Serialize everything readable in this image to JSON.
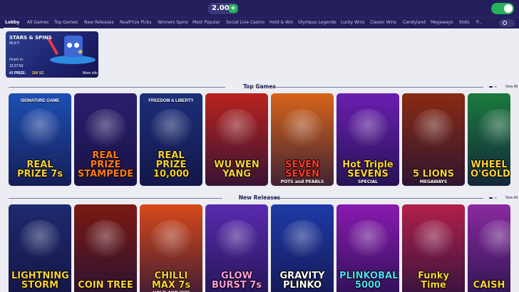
{
  "header": {
    "balance": "2.00",
    "add_icon": "plus-icon",
    "toggle_state": "on",
    "accent_color": "#27b35a",
    "bar_color": "#221f5c"
  },
  "nav": {
    "items": [
      {
        "label": "Lobby",
        "active": true
      },
      {
        "label": "All Games"
      },
      {
        "label": "Top Games"
      },
      {
        "label": "New Releases"
      },
      {
        "label": "RealPrize Picks"
      },
      {
        "label": "Winners Spins"
      },
      {
        "label": "Most Popular"
      },
      {
        "label": "Social Live Casino"
      },
      {
        "label": "Hold & Win"
      },
      {
        "label": "Olympus Legends"
      },
      {
        "label": "Lucky Wins"
      },
      {
        "label": "Classic Wins"
      },
      {
        "label": "Candyland"
      },
      {
        "label": "Megaways"
      },
      {
        "label": "Slots"
      },
      {
        "label": "P..."
      }
    ],
    "search_icon": "search-icon"
  },
  "promo": {
    "title": "STARS & SPINS",
    "subtitle": "MULTI",
    "finish_label": "Finish in:",
    "finish_time": "12:27:53",
    "prize_label": "#1 PRIZE:",
    "prize_value": "200 SC",
    "more_info": "More info"
  },
  "top_games": {
    "title": "Top Games",
    "view_all": "View All",
    "games": [
      {
        "title": "REAL PRIZE 7s",
        "badge": "SIGNATURE GAME",
        "sub": "",
        "bg": "#1d4fb4",
        "fg": "#f5cf3a"
      },
      {
        "title": "REAL PRIZE STAMPEDE",
        "badge": "",
        "sub": "",
        "bg": "#2b1e6e",
        "fg": "#ff7a1a"
      },
      {
        "title": "REAL PRIZE 10,000",
        "badge": "FREEDOM & LIBERTY",
        "sub": "",
        "bg": "#1b2f7a",
        "fg": "#f5cf3a"
      },
      {
        "title": "WU WEN YANG",
        "badge": "",
        "sub": "",
        "bg": "#b8231e",
        "fg": "#ffd23a"
      },
      {
        "title": "SEVEN SEVEN",
        "badge": "",
        "sub": "POTS and PEARLS",
        "bg": "#d8641a",
        "fg": "#ff3b2a"
      },
      {
        "title": "Hot Triple SEVENS",
        "badge": "",
        "sub": "SPECIAL",
        "bg": "#6a1fb0",
        "fg": "#ffd23a"
      },
      {
        "title": "5 LIONS",
        "badge": "",
        "sub": "MEGAWAYS",
        "bg": "#8a2a12",
        "fg": "#ffd23a"
      },
      {
        "title": "WHEEL O'GOLD",
        "badge": "",
        "sub": "",
        "bg": "#1a7a3c",
        "fg": "#ffd23a"
      }
    ]
  },
  "new_releases": {
    "title": "New Releases",
    "view_all": "View All",
    "games": [
      {
        "title": "LIGHTNING STORM",
        "sub": "",
        "bg": "#1e2a6e",
        "fg": "#f5cf3a"
      },
      {
        "title": "COIN TREE",
        "sub": "",
        "bg": "#7a1a12",
        "fg": "#ffd23a"
      },
      {
        "title": "CHILLI MAX 7s",
        "sub": "HOLD AND WIN",
        "bg": "#d8491a",
        "fg": "#ffd23a"
      },
      {
        "title": "GLOW BURST 7s",
        "sub": "",
        "bg": "#5a2ab0",
        "fg": "#ff9de0"
      },
      {
        "title": "GRAVITY PLINKO",
        "sub": "",
        "bg": "#1e3aa8",
        "fg": "#ffffff"
      },
      {
        "title": "PLINKOBALL 5000",
        "sub": "",
        "bg": "#8a1ab0",
        "fg": "#54d8ff"
      },
      {
        "title": "Funky Time",
        "sub": "",
        "bg": "#b0204a",
        "fg": "#ffd23a"
      },
      {
        "title": "CAISH",
        "sub": "",
        "bg": "#8a2aa0",
        "fg": "#ffd23a"
      }
    ]
  }
}
